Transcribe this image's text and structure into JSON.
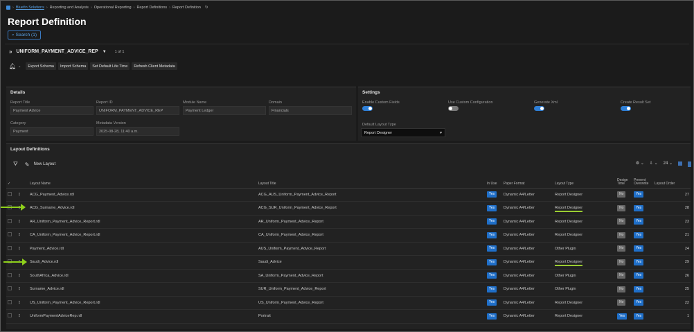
{
  "breadcrumb": {
    "items": [
      "Bluefin Solutions",
      "Reporting and Analysis",
      "Operational Reporting",
      "Report Definitions",
      "Report Definition"
    ],
    "refresh_icon": "refresh-icon"
  },
  "page": {
    "title": "Report Definition"
  },
  "search": {
    "label": "Search (1)"
  },
  "report_selector": {
    "name": "UNIFORM_PAYMENT_ADVICE_REP",
    "count": "1 of 1"
  },
  "toolbar": {
    "buttons": [
      "Export Schema",
      "Import Schema",
      "Set Default Life Time",
      "Refresh Client Metadata"
    ]
  },
  "details": {
    "header": "Details",
    "fields": [
      {
        "label": "Report Title",
        "value": "Payment Advice"
      },
      {
        "label": "Report ID",
        "value": "UNIFORM_PAYMENT_ADVICE_REP"
      },
      {
        "label": "Module Name",
        "value": "Payment Ledger"
      },
      {
        "label": "Domain",
        "value": "Financials"
      },
      {
        "label": "Category",
        "value": "Payment"
      },
      {
        "label": "Metadata Version",
        "value": "2025-08-28, 11:40 a.m."
      }
    ]
  },
  "settings": {
    "header": "Settings",
    "toggles": [
      {
        "label": "Enable Custom Fields",
        "on": true
      },
      {
        "label": "Use Custom Configuration",
        "on": false
      },
      {
        "label": "Generate Xml",
        "on": true
      },
      {
        "label": "Create Result Set",
        "on": true
      }
    ],
    "layout_type_label": "Default Layout Type",
    "layout_type_value": "Report Designer"
  },
  "layouts": {
    "header": "Layout Definitions",
    "new_layout_label": "New Layout",
    "page_size": "24",
    "columns": {
      "name": "Layout Name",
      "title": "Layout Title",
      "in_use": "In Use",
      "paper": "Paper Format",
      "type": "Layout Type",
      "design_time": "Design Time",
      "prevent_overwrite": "Prevent Overwrite",
      "order": "Layout Order"
    },
    "rows": [
      {
        "name": "ACG_Payment_Advice.rdl",
        "title": "ACG_AUS_Uniform_Payment_Advice_Report",
        "in_use": "Yes",
        "paper": "Dynamic A4/Letter",
        "type": "Report Designer",
        "design": "No",
        "prevent": "Yes",
        "order": "27"
      },
      {
        "name": "ACG_Surname_Advice.rdl",
        "title": "ACG_SUR_Uniform_Payment_Advice_Report",
        "in_use": "Yes",
        "paper": "Dynamic A4/Letter",
        "type": "Report Designer",
        "design": "No",
        "prevent": "Yes",
        "order": "28"
      },
      {
        "name": "AR_Uniform_Payment_Advice_Report.rdl",
        "title": "AR_Uniform_Payment_Advice_Report",
        "in_use": "Yes",
        "paper": "Dynamic A4/Letter",
        "type": "Report Designer",
        "design": "No",
        "prevent": "Yes",
        "order": "23"
      },
      {
        "name": "CA_Uniform_Payment_Advice_Report.rdl",
        "title": "CA_Uniform_Payment_Advice_Report",
        "in_use": "Yes",
        "paper": "Dynamic A4/Letter",
        "type": "Report Designer",
        "design": "No",
        "prevent": "Yes",
        "order": "21"
      },
      {
        "name": "Payment_Advice.rdl",
        "title": "AUS_Uniform_Payment_Advice_Report",
        "in_use": "Yes",
        "paper": "Dynamic A4/Letter",
        "type": "Other Plugin",
        "design": "No",
        "prevent": "Yes",
        "order": "24"
      },
      {
        "name": "Saudi_Advice.rdl",
        "title": "Saudi_Advice",
        "in_use": "Yes",
        "paper": "Dynamic A4/Letter",
        "type": "Report Designer",
        "design": "No",
        "prevent": "Yes",
        "order": "29"
      },
      {
        "name": "SouthAfrica_Advice.rdl",
        "title": "SA_Uniform_Payment_Advice_Report",
        "in_use": "Yes",
        "paper": "Dynamic A4/Letter",
        "type": "Other Plugin",
        "design": "No",
        "prevent": "Yes",
        "order": "26"
      },
      {
        "name": "Surname_Advice.rdl",
        "title": "SUR_Uniform_Payment_Advice_Report",
        "in_use": "Yes",
        "paper": "Dynamic A4/Letter",
        "type": "Other Plugin",
        "design": "No",
        "prevent": "Yes",
        "order": "25"
      },
      {
        "name": "US_Uniform_Payment_Advice_Report.rdl",
        "title": "US_Uniform_Payment_Advice_Report",
        "in_use": "Yes",
        "paper": "Dynamic A4/Letter",
        "type": "Report Designer",
        "design": "No",
        "prevent": "Yes",
        "order": "22"
      },
      {
        "name": "UniformPaymentAdviceRep.rdl",
        "title": "Portrait",
        "in_use": "Yes",
        "paper": "Dynamic A4/Letter",
        "type": "Report Designer",
        "design": "Yes",
        "prevent": "Yes",
        "order": "1"
      }
    ]
  },
  "colors": {
    "accent": "#1f6fc9",
    "highlight": "#8fd11b"
  }
}
